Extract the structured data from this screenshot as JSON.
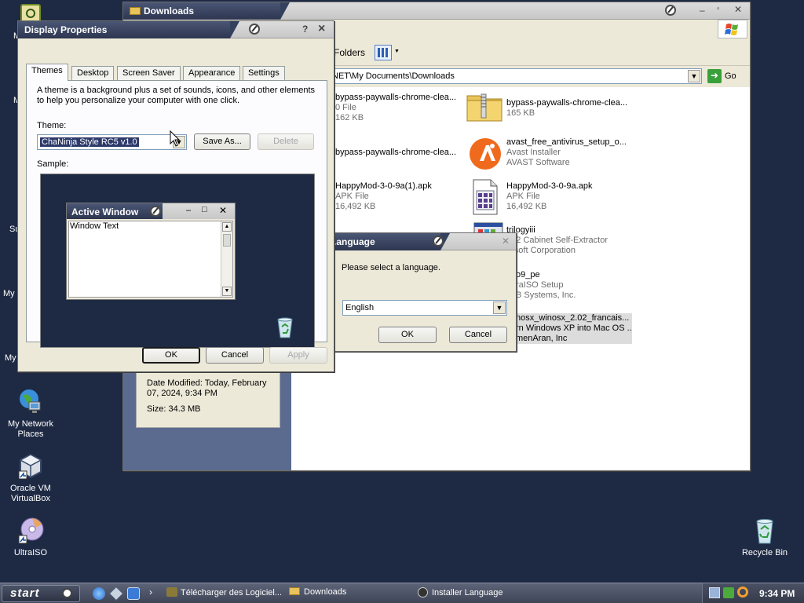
{
  "desktop": {
    "partial_labels": [
      "M",
      "M",
      "Su",
      "My I",
      "My"
    ],
    "icons": [
      {
        "label_1": "My Network",
        "label_2": "Places",
        "icon": "network-places-icon"
      },
      {
        "label_1": "Oracle VM",
        "label_2": "VirtualBox",
        "icon": "virtualbox-icon"
      },
      {
        "label_1": "UltraISO",
        "label_2": "",
        "icon": "ultraiso-icon"
      },
      {
        "label_1": "Recycle Bin",
        "label_2": "",
        "icon": "recycle-bin-icon"
      }
    ]
  },
  "explorer": {
    "title": "Downloads",
    "toolbar_folders": "Folders",
    "address": "NET\\My Documents\\Downloads",
    "go_label": "Go",
    "details": {
      "date_modified": "Date Modified: Today, February 07, 2024, 9:34 PM",
      "date_line1": "Date Modified: Today, February",
      "date_line2": "07, 2024, 9:34 PM",
      "size": "Size: 34.3 MB"
    },
    "files": [
      {
        "name": "bypass-paywalls-chrome-clea...",
        "type": "0 File",
        "size": "162 KB"
      },
      {
        "name": "bypass-paywalls-chrome-clea...",
        "type": "165 KB",
        "size": ""
      },
      {
        "name": "bypass-paywalls-chrome-clea...",
        "type": "",
        "size": ""
      },
      {
        "name": "avast_free_antivirus_setup_o...",
        "type": "Avast Installer",
        "size": "AVAST Software"
      },
      {
        "name": "HappyMod-3-0-9a(1).apk",
        "type": "APK File",
        "size": "16,492 KB"
      },
      {
        "name": "HappyMod-3-0-9a.apk",
        "type": "APK File",
        "size": "16,492 KB"
      },
      {
        "name": "trilogyiii",
        "type": "n32 Cabinet Self-Extractor",
        "size": "rosoft Corporation"
      },
      {
        "name": "o9_pe",
        "type": "raISO Setup",
        "size": "B Systems, Inc."
      },
      {
        "name": "nosx_winosx_2.02_francais...",
        "type": "rn Windows XP into Mac OS ...",
        "size": "menAran, Inc"
      }
    ]
  },
  "display_properties": {
    "title": "Display Properties",
    "help": "?",
    "close": "×",
    "tabs": [
      "Themes",
      "Desktop",
      "Screen Saver",
      "Appearance",
      "Settings"
    ],
    "description_1": "A theme is a background plus a set of sounds, icons, and other elements",
    "description_2": "to help you personalize your computer with one click.",
    "theme_label": "Theme:",
    "theme_value": "ChaNinja Style RC5 v1.0",
    "save_as": "Save As...",
    "delete": "Delete",
    "sample_label": "Sample:",
    "sample_window_title": "Active Window",
    "sample_window_text": "Window Text",
    "ok": "OK",
    "cancel": "Cancel",
    "apply": "Apply"
  },
  "language_dialog": {
    "title": "Language",
    "title_visible": ".anguage",
    "prompt": "Please select a language.",
    "selected": "English",
    "ok": "OK",
    "cancel": "Cancel"
  },
  "taskbar": {
    "start": "start",
    "items": [
      "Télécharger des Logiciel...",
      "Downloads",
      "Installer Language"
    ],
    "clock": "9:34 PM"
  }
}
